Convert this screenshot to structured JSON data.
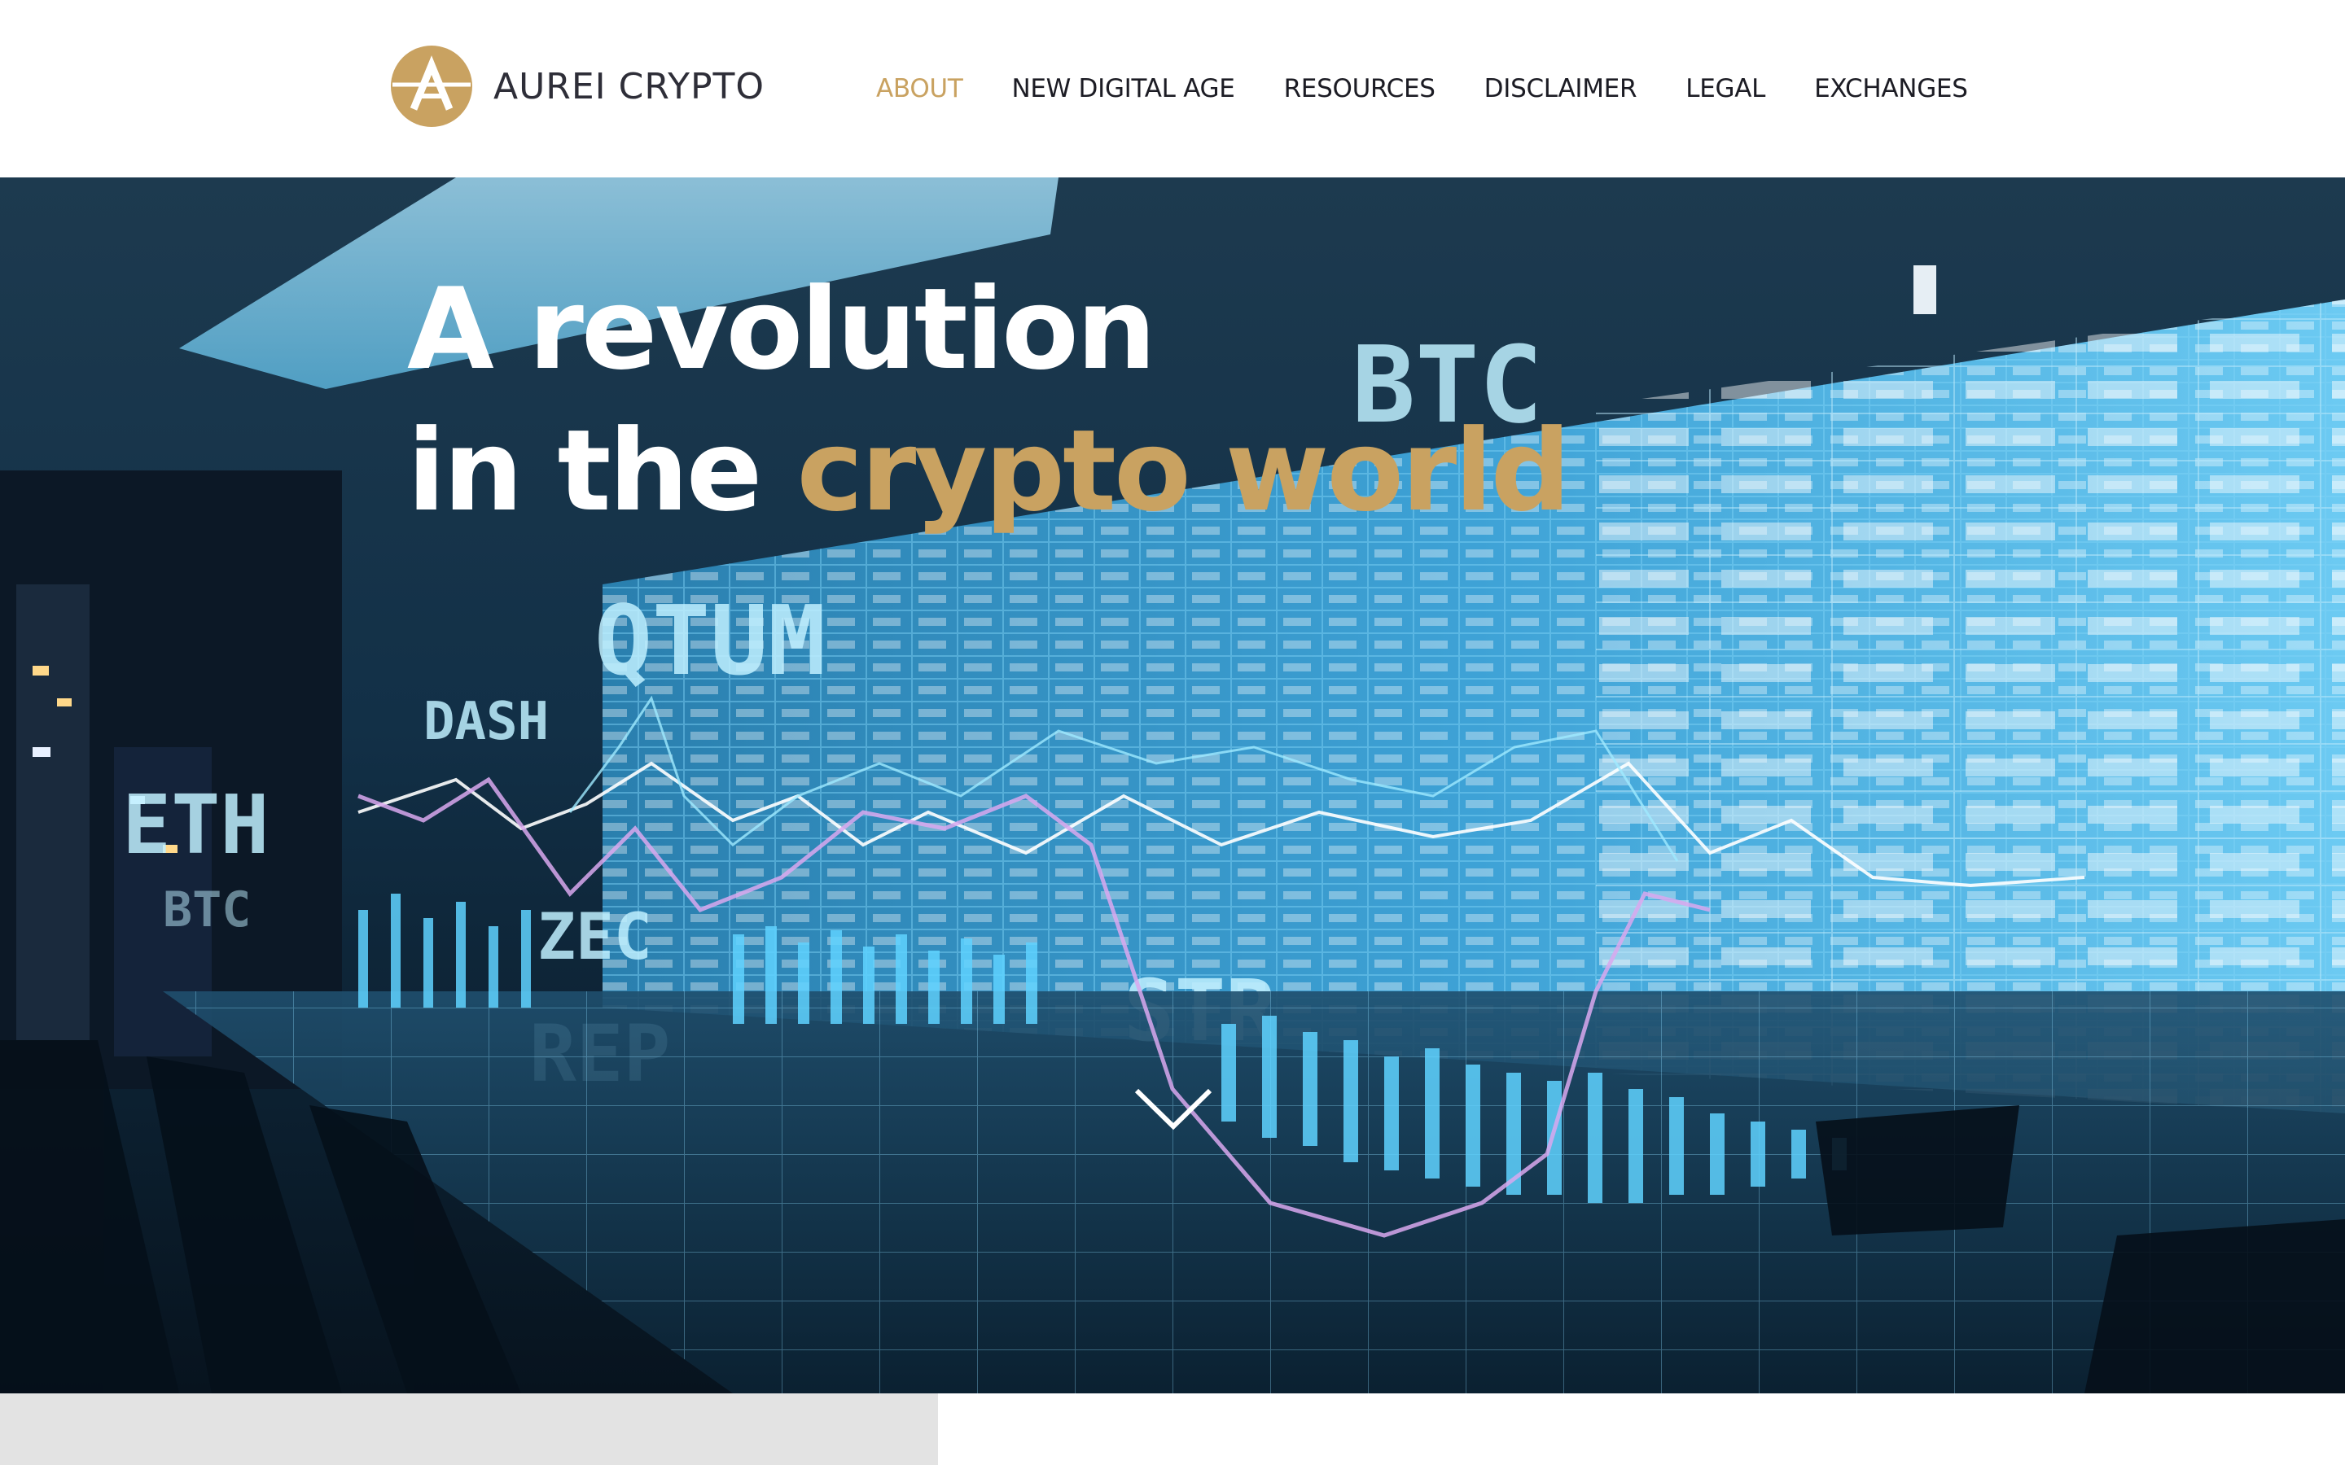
{
  "brand": {
    "name": "AUREI CRYPTO",
    "logo_icon": "aurei-a-coin-icon",
    "logo_color": "#c9a261"
  },
  "nav": {
    "items": [
      {
        "label": "ABOUT",
        "active": true
      },
      {
        "label": "NEW DIGITAL AGE",
        "active": false
      },
      {
        "label": "RESOURCES",
        "active": false
      },
      {
        "label": "DISCLAIMER",
        "active": false
      },
      {
        "label": "LEGAL",
        "active": false
      },
      {
        "label": "EXCHANGES",
        "active": false
      }
    ],
    "active_color": "#c9a261"
  },
  "hero": {
    "headline_line1": "A revolution",
    "headline_line2_prefix": "in the",
    "headline_line2_accent": "crypto world",
    "accent_color": "#c9a261",
    "scroll_icon": "chevron-down-icon",
    "ticker_symbols": [
      "BTC",
      "QTUM",
      "DASH",
      "ETH",
      "ZEC",
      "REP",
      "STR"
    ]
  },
  "colors": {
    "text_dark": "#1c1c24",
    "screen_blue": "#4fb6e6",
    "footer_left": "#e3e3e3"
  }
}
